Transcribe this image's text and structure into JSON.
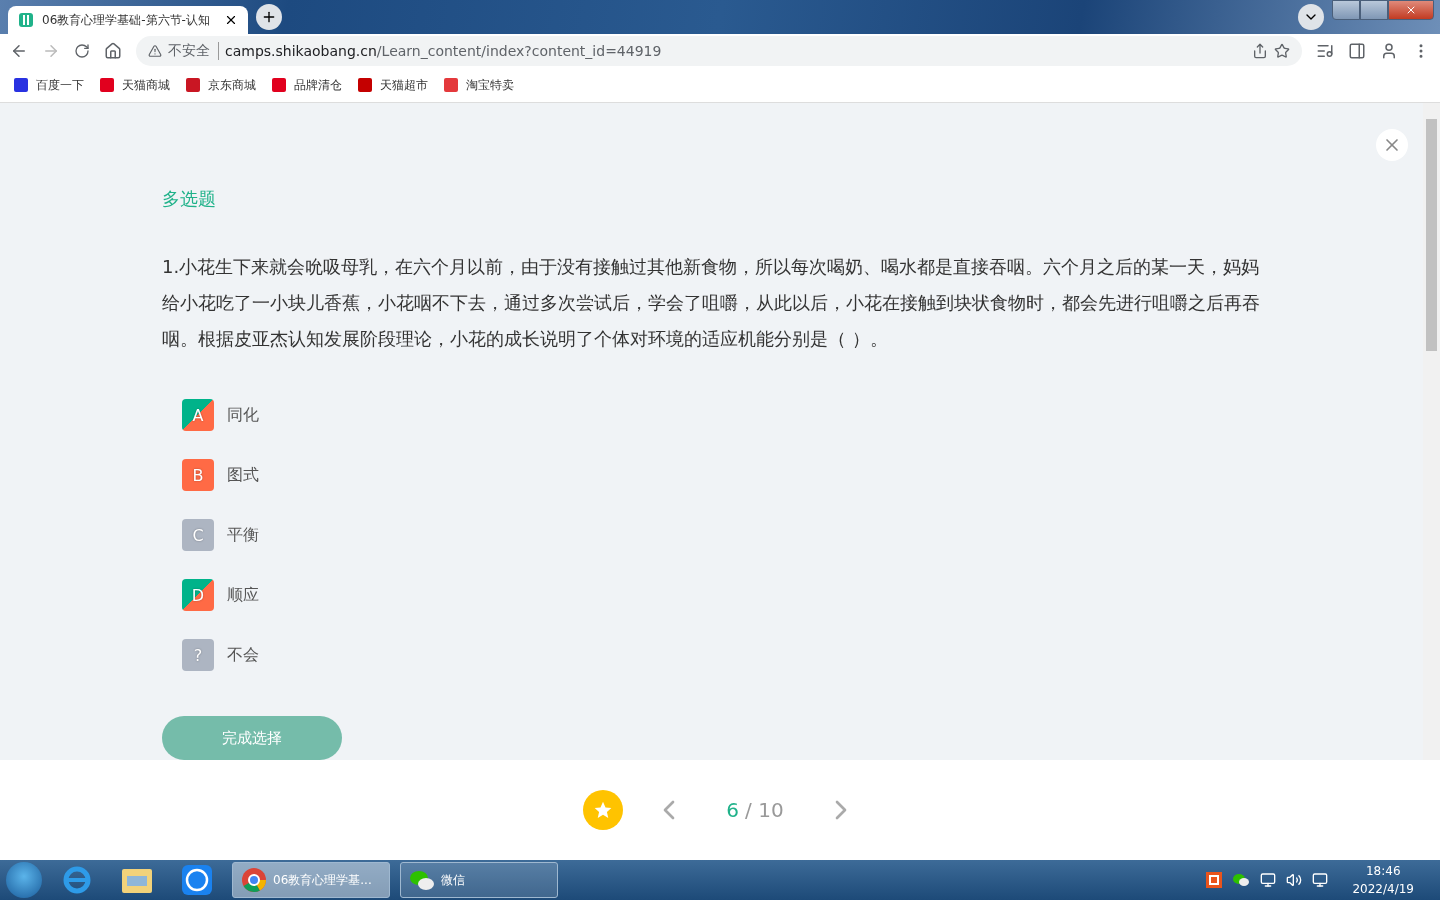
{
  "browser": {
    "tab_title": "06教育心理学基础-第六节-认知",
    "security": "不安全",
    "url_host": "camps.shikaobang.cn",
    "url_path": "/Learn_content/index?content_id=44919",
    "bookmarks": [
      {
        "label": "百度一下",
        "color": "#2932e1"
      },
      {
        "label": "天猫商城",
        "color": "#e1001e"
      },
      {
        "label": "京东商城",
        "color": "#c91623"
      },
      {
        "label": "品牌清仓",
        "color": "#e1001e"
      },
      {
        "label": "天猫超市",
        "color": "#c40000"
      },
      {
        "label": "淘宝特卖",
        "color": "#e4393c"
      }
    ]
  },
  "question": {
    "type_label": "多选题",
    "text": "1.小花生下来就会吮吸母乳，在六个月以前，由于没有接触过其他新食物，所以每次喝奶、喝水都是直接吞咽。六个月之后的某一天，妈妈给小花吃了一小块儿香蕉，小花咽不下去，通过多次尝试后，学会了咀嚼，从此以后，小花在接触到块状食物时，都会先进行咀嚼之后再吞咽。根据皮亚杰认知发展阶段理论，小花的成长说明了个体对环境的适应机能分别是（ ）。",
    "options": [
      {
        "letter": "A",
        "label": "同化",
        "kind": "correct"
      },
      {
        "letter": "B",
        "label": "图式",
        "kind": "wrong"
      },
      {
        "letter": "C",
        "label": "平衡",
        "kind": "plain"
      },
      {
        "letter": "D",
        "label": "顺应",
        "kind": "correct"
      },
      {
        "letter": "?",
        "label": "不会",
        "kind": "plain"
      }
    ],
    "submit": "完成选择"
  },
  "pager": {
    "current": "6",
    "total": "/ 10",
    "starred": true
  },
  "taskbar": {
    "windows": [
      {
        "label": "06教育心理学基...",
        "selected": true
      },
      {
        "label": "微信",
        "selected": false
      }
    ],
    "time": "18:46",
    "date": "2022/4/19"
  }
}
